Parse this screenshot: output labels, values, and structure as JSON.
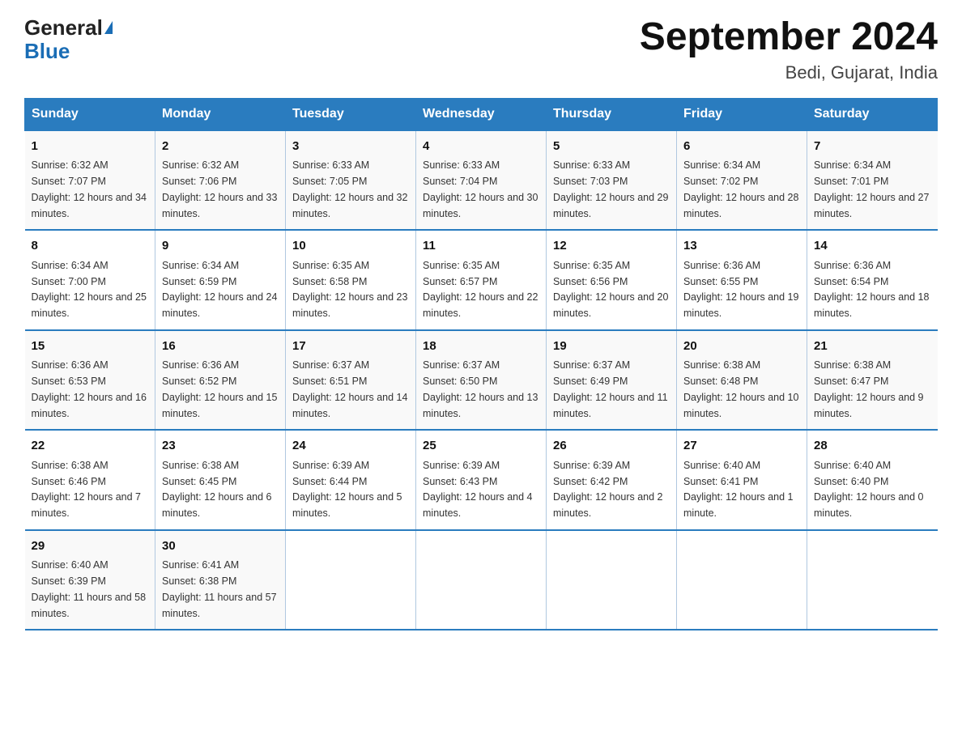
{
  "header": {
    "logo_general": "General",
    "logo_blue": "Blue",
    "title": "September 2024",
    "subtitle": "Bedi, Gujarat, India"
  },
  "days_of_week": [
    "Sunday",
    "Monday",
    "Tuesday",
    "Wednesday",
    "Thursday",
    "Friday",
    "Saturday"
  ],
  "weeks": [
    [
      {
        "day": "1",
        "sunrise": "6:32 AM",
        "sunset": "7:07 PM",
        "daylight": "12 hours and 34 minutes."
      },
      {
        "day": "2",
        "sunrise": "6:32 AM",
        "sunset": "7:06 PM",
        "daylight": "12 hours and 33 minutes."
      },
      {
        "day": "3",
        "sunrise": "6:33 AM",
        "sunset": "7:05 PM",
        "daylight": "12 hours and 32 minutes."
      },
      {
        "day": "4",
        "sunrise": "6:33 AM",
        "sunset": "7:04 PM",
        "daylight": "12 hours and 30 minutes."
      },
      {
        "day": "5",
        "sunrise": "6:33 AM",
        "sunset": "7:03 PM",
        "daylight": "12 hours and 29 minutes."
      },
      {
        "day": "6",
        "sunrise": "6:34 AM",
        "sunset": "7:02 PM",
        "daylight": "12 hours and 28 minutes."
      },
      {
        "day": "7",
        "sunrise": "6:34 AM",
        "sunset": "7:01 PM",
        "daylight": "12 hours and 27 minutes."
      }
    ],
    [
      {
        "day": "8",
        "sunrise": "6:34 AM",
        "sunset": "7:00 PM",
        "daylight": "12 hours and 25 minutes."
      },
      {
        "day": "9",
        "sunrise": "6:34 AM",
        "sunset": "6:59 PM",
        "daylight": "12 hours and 24 minutes."
      },
      {
        "day": "10",
        "sunrise": "6:35 AM",
        "sunset": "6:58 PM",
        "daylight": "12 hours and 23 minutes."
      },
      {
        "day": "11",
        "sunrise": "6:35 AM",
        "sunset": "6:57 PM",
        "daylight": "12 hours and 22 minutes."
      },
      {
        "day": "12",
        "sunrise": "6:35 AM",
        "sunset": "6:56 PM",
        "daylight": "12 hours and 20 minutes."
      },
      {
        "day": "13",
        "sunrise": "6:36 AM",
        "sunset": "6:55 PM",
        "daylight": "12 hours and 19 minutes."
      },
      {
        "day": "14",
        "sunrise": "6:36 AM",
        "sunset": "6:54 PM",
        "daylight": "12 hours and 18 minutes."
      }
    ],
    [
      {
        "day": "15",
        "sunrise": "6:36 AM",
        "sunset": "6:53 PM",
        "daylight": "12 hours and 16 minutes."
      },
      {
        "day": "16",
        "sunrise": "6:36 AM",
        "sunset": "6:52 PM",
        "daylight": "12 hours and 15 minutes."
      },
      {
        "day": "17",
        "sunrise": "6:37 AM",
        "sunset": "6:51 PM",
        "daylight": "12 hours and 14 minutes."
      },
      {
        "day": "18",
        "sunrise": "6:37 AM",
        "sunset": "6:50 PM",
        "daylight": "12 hours and 13 minutes."
      },
      {
        "day": "19",
        "sunrise": "6:37 AM",
        "sunset": "6:49 PM",
        "daylight": "12 hours and 11 minutes."
      },
      {
        "day": "20",
        "sunrise": "6:38 AM",
        "sunset": "6:48 PM",
        "daylight": "12 hours and 10 minutes."
      },
      {
        "day": "21",
        "sunrise": "6:38 AM",
        "sunset": "6:47 PM",
        "daylight": "12 hours and 9 minutes."
      }
    ],
    [
      {
        "day": "22",
        "sunrise": "6:38 AM",
        "sunset": "6:46 PM",
        "daylight": "12 hours and 7 minutes."
      },
      {
        "day": "23",
        "sunrise": "6:38 AM",
        "sunset": "6:45 PM",
        "daylight": "12 hours and 6 minutes."
      },
      {
        "day": "24",
        "sunrise": "6:39 AM",
        "sunset": "6:44 PM",
        "daylight": "12 hours and 5 minutes."
      },
      {
        "day": "25",
        "sunrise": "6:39 AM",
        "sunset": "6:43 PM",
        "daylight": "12 hours and 4 minutes."
      },
      {
        "day": "26",
        "sunrise": "6:39 AM",
        "sunset": "6:42 PM",
        "daylight": "12 hours and 2 minutes."
      },
      {
        "day": "27",
        "sunrise": "6:40 AM",
        "sunset": "6:41 PM",
        "daylight": "12 hours and 1 minute."
      },
      {
        "day": "28",
        "sunrise": "6:40 AM",
        "sunset": "6:40 PM",
        "daylight": "12 hours and 0 minutes."
      }
    ],
    [
      {
        "day": "29",
        "sunrise": "6:40 AM",
        "sunset": "6:39 PM",
        "daylight": "11 hours and 58 minutes."
      },
      {
        "day": "30",
        "sunrise": "6:41 AM",
        "sunset": "6:38 PM",
        "daylight": "11 hours and 57 minutes."
      },
      null,
      null,
      null,
      null,
      null
    ]
  ],
  "labels": {
    "sunrise": "Sunrise:",
    "sunset": "Sunset:",
    "daylight": "Daylight:"
  }
}
